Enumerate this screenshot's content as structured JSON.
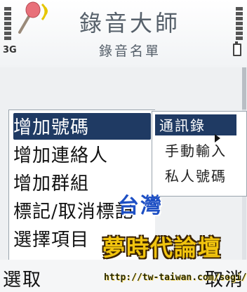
{
  "status": {
    "network": "3G"
  },
  "app": {
    "title": "錄音大師",
    "subtitle": "錄音名單"
  },
  "menu": {
    "items": [
      {
        "label": "增加號碼",
        "selected": true
      },
      {
        "label": "增加連絡人"
      },
      {
        "label": "增加群組"
      },
      {
        "label": "標記/取消標記"
      },
      {
        "label": "選擇項目"
      }
    ]
  },
  "submenu": {
    "items": [
      {
        "label": "通訊錄",
        "selected": true
      },
      {
        "label": "手動輸入"
      },
      {
        "label": "私人號碼"
      }
    ]
  },
  "watermark": {
    "line1": "台灣",
    "line2": "夢時代論壇",
    "url": "http://tw-taiwan.com/sogi/"
  },
  "softkeys": {
    "left": "選取",
    "right": "取消"
  },
  "colors": {
    "selection": "#1f3a63",
    "watermark_blue": "#1d4fc4",
    "watermark_yellow": "#f1c40f"
  },
  "icons": {
    "app": "microphone-icon"
  }
}
